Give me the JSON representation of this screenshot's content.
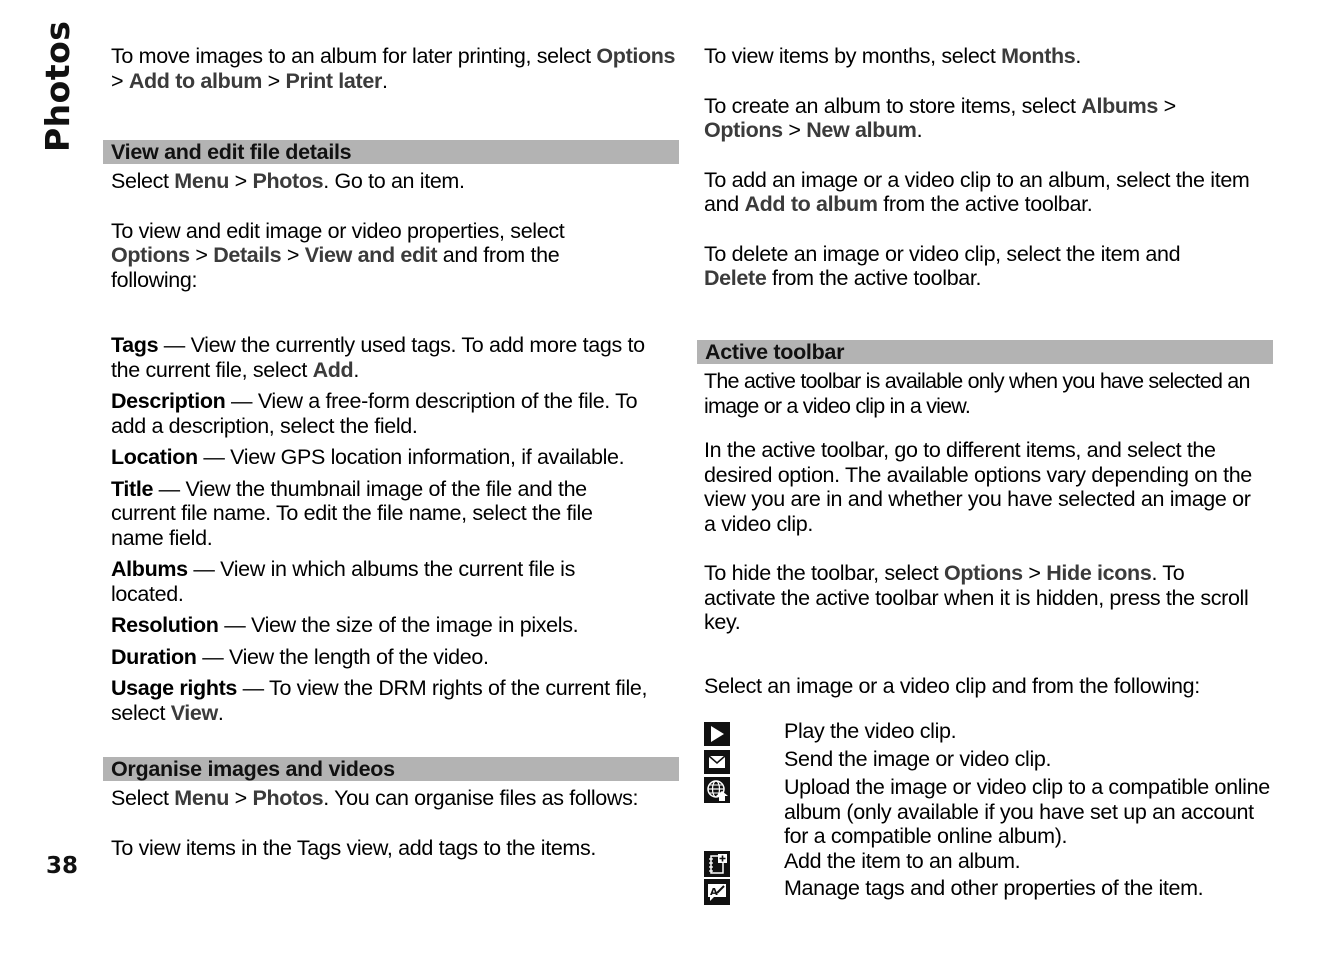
{
  "page": {
    "section_title": "Photos",
    "page_number": "38"
  },
  "left": {
    "p1": {
      "t1": "To move images to an album for later printing, select ",
      "b1": "Options",
      "sep1": "  > ",
      "b2": "Add to album",
      "sep2": "  > ",
      "b3": "Print later",
      "end": "."
    },
    "heading1": "View and edit file details",
    "p2": {
      "t1": "Select ",
      "b1": "Menu",
      "sep1": "  > ",
      "b2": "Photos",
      "end": ". Go to an item."
    },
    "p3": {
      "t1": "To view and edit image or video properties, select ",
      "b1": "Options",
      "sep1": "  > ",
      "b2": "Details",
      "sep2": "  > ",
      "b3": "View and edit",
      "end": " and from the following:"
    },
    "properties": [
      {
        "term": "Tags",
        "text": "  — View the currently used tags. To add more tags to the current file, select ",
        "ui": "Add",
        "end": "."
      },
      {
        "term": "Description",
        "text": "  — View a free-form description of the file. To add a description, select the field.",
        "ui": "",
        "end": ""
      },
      {
        "term": "Location",
        "text": "  — View GPS location information, if available.",
        "ui": "",
        "end": ""
      },
      {
        "term": "Title",
        "text": "  — View the thumbnail image of the file and the current file name. To edit the file name, select the file name field.",
        "ui": "",
        "end": ""
      },
      {
        "term": "Albums",
        "text": "  — View in which albums the current file is located.",
        "ui": "",
        "end": ""
      },
      {
        "term": "Resolution",
        "text": "  — View the size of the image in pixels.",
        "ui": "",
        "end": ""
      },
      {
        "term": "Duration",
        "text": "  — View the length of the video.",
        "ui": "",
        "end": ""
      },
      {
        "term": "Usage rights",
        "text": "  — To view the DRM rights of the current file, select ",
        "ui": "View",
        "end": "."
      }
    ],
    "heading2": "Organise images and videos",
    "p4": {
      "t1": "Select ",
      "b1": "Menu",
      "sep1": "  > ",
      "b2": "Photos",
      "end": ". You can organise files as follows:"
    },
    "p5": "To view items in the Tags view, add tags to the items."
  },
  "right": {
    "p1": {
      "t1": "To view items by months, select ",
      "b1": "Months",
      "end": "."
    },
    "p2": {
      "t1": "To create an album to store items, select ",
      "b1": "Albums",
      "sep1": "  > ",
      "b2": "Options",
      "sep2": "  > ",
      "b3": "New album",
      "end": "."
    },
    "p3": {
      "t1": "To add an image or a video clip to an album, select the item and ",
      "b1": "Add to album",
      "end": " from the active toolbar."
    },
    "p4": {
      "b1": "Delete",
      "t0": "To delete an image or video clip, select the item and ",
      "end": " from the active toolbar."
    },
    "heading": "Active toolbar",
    "p5": "The active toolbar is available only when you have selected an image or a video clip in a view.",
    "p6": "In the active toolbar, go to different items, and select the desired option. The available options vary depending on the view you are in and whether you have selected an image or a video clip.",
    "p7": {
      "t1": "To hide the toolbar, select ",
      "b1": "Options",
      "sep1": "  > ",
      "b2": "Hide icons",
      "end": ". To activate the active toolbar when it is hidden, press the scroll key."
    },
    "p8": "Select an image or a video clip and from the following:",
    "toolbar_items": [
      {
        "icon": "play-icon",
        "text": "Play the video clip."
      },
      {
        "icon": "envelope-icon",
        "text": "Send the image or video clip."
      },
      {
        "icon": "globe-upload-icon",
        "text": "Upload the image or video clip to a compatible online album (only available if you have set up an account for a compatible online album)."
      },
      {
        "icon": "add-to-album-icon",
        "text": "Add the item to an album."
      },
      {
        "icon": "tag-properties-icon",
        "text": "Manage tags and other properties of the item."
      }
    ]
  }
}
